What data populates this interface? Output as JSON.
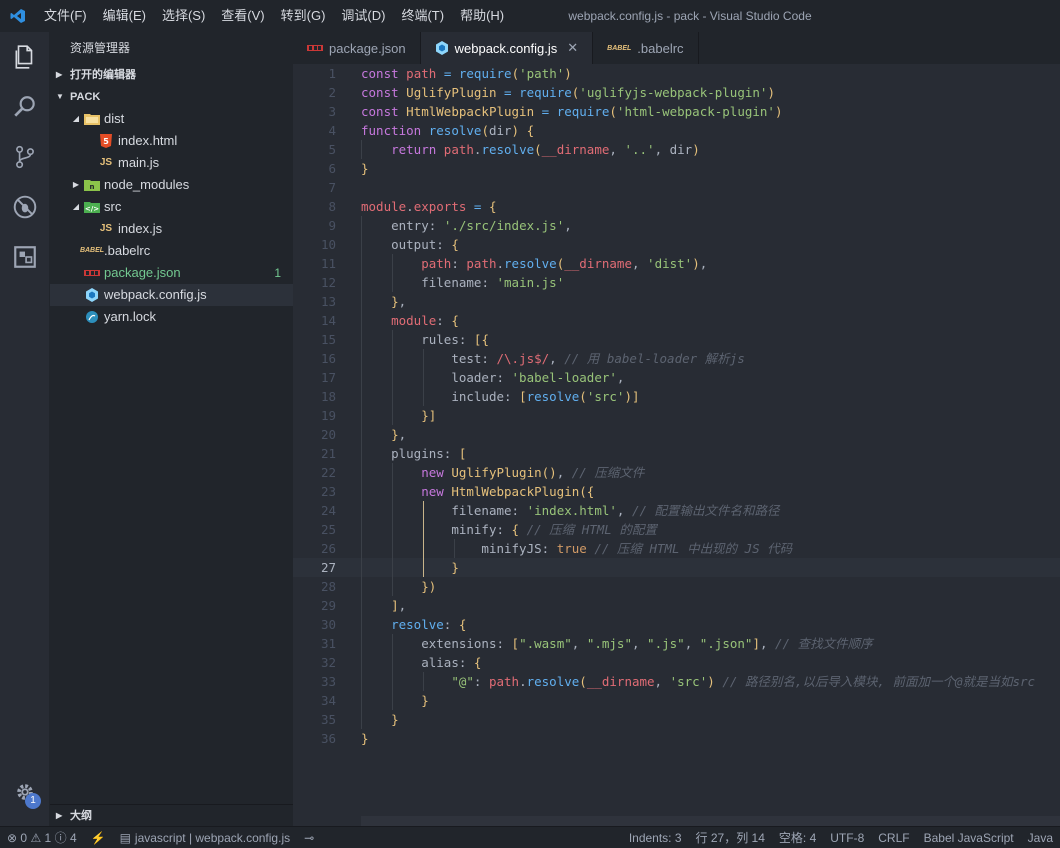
{
  "titlebar": {
    "title": "webpack.config.js - pack - Visual Studio Code",
    "menu": [
      "文件(F)",
      "编辑(E)",
      "选择(S)",
      "查看(V)",
      "转到(G)",
      "调试(D)",
      "终端(T)",
      "帮助(H)"
    ]
  },
  "activity": {
    "items": [
      "files-icon",
      "search-icon",
      "source-control-icon",
      "debug-icon",
      "extensions-icon"
    ],
    "settings_badge": "1"
  },
  "sidebar": {
    "title": "资源管理器",
    "open_editors": "打开的编辑器",
    "folder": "PACK",
    "outline": "大纲",
    "tree": [
      {
        "name": "dist",
        "type": "folder",
        "level": 0
      },
      {
        "name": "index.html",
        "type": "html",
        "level": 1
      },
      {
        "name": "main.js",
        "type": "js",
        "level": 1
      },
      {
        "name": "node_modules",
        "type": "folder",
        "level": 0
      },
      {
        "name": "src",
        "type": "folder",
        "level": 0
      },
      {
        "name": "index.js",
        "type": "js",
        "level": 1
      },
      {
        "name": ".babelrc",
        "type": "babel",
        "level": 0
      },
      {
        "name": "package.json",
        "type": "npm",
        "level": 0,
        "badge": "1"
      },
      {
        "name": "webpack.config.js",
        "type": "webpack",
        "level": 0
      },
      {
        "name": "yarn.lock",
        "type": "yarn",
        "level": 0
      }
    ]
  },
  "tabs": [
    {
      "label": "package.json"
    },
    {
      "label": "webpack.config.js"
    },
    {
      "label": ".babelrc"
    }
  ],
  "editor": {
    "lines": [
      "const path = require('path')",
      "const UglifyPlugin = require('uglifyjs-webpack-plugin')",
      "const HtmlWebpackPlugin = require('html-webpack-plugin')",
      "function resolve(dir) {",
      "    return path.resolve(__dirname, '..', dir)",
      "}",
      "",
      "module.exports = {",
      "    entry: './src/index.js',",
      "    output: {",
      "        path: path.resolve(__dirname, 'dist'),",
      "        filename: 'main.js'",
      "    },",
      "    module: {",
      "        rules: [{",
      "            test: /\\.js$/, // 用 babel-loader 解析js",
      "            loader: 'babel-loader',",
      "            include: [resolve('src')]",
      "        }]",
      "    },",
      "    plugins: [",
      "        new UglifyPlugin(), // 压缩文件",
      "        new HtmlWebpackPlugin({",
      "            filename: 'index.html', // 配置输出文件名和路径",
      "            minify: { // 压缩 HTML 的配置",
      "                minifyJS: true // 压缩 HTML 中出现的 JS 代码",
      "            }",
      "        })",
      "    ],",
      "    resolve: {",
      "        extensions: [\".wasm\", \".mjs\", \".js\", \".json\"], // 查找文件顺序",
      "        alias: {",
      "            \"@\": path.resolve(__dirname, 'src') // 路径别名,以后导入模块, 前面加一个@就是当如src",
      "        }",
      "    }",
      "}"
    ],
    "current_line": 27
  },
  "statusbar": {
    "errors": "0",
    "warnings": "1",
    "infos": "4",
    "breadcrumb": "javascript | webpack.config.js",
    "indents": "Indents: 3",
    "position": "行 27，列 14",
    "spaces": "空格: 4",
    "encoding": "UTF-8",
    "eol": "CRLF",
    "language": "Babel JavaScript",
    "extra": "Java"
  }
}
